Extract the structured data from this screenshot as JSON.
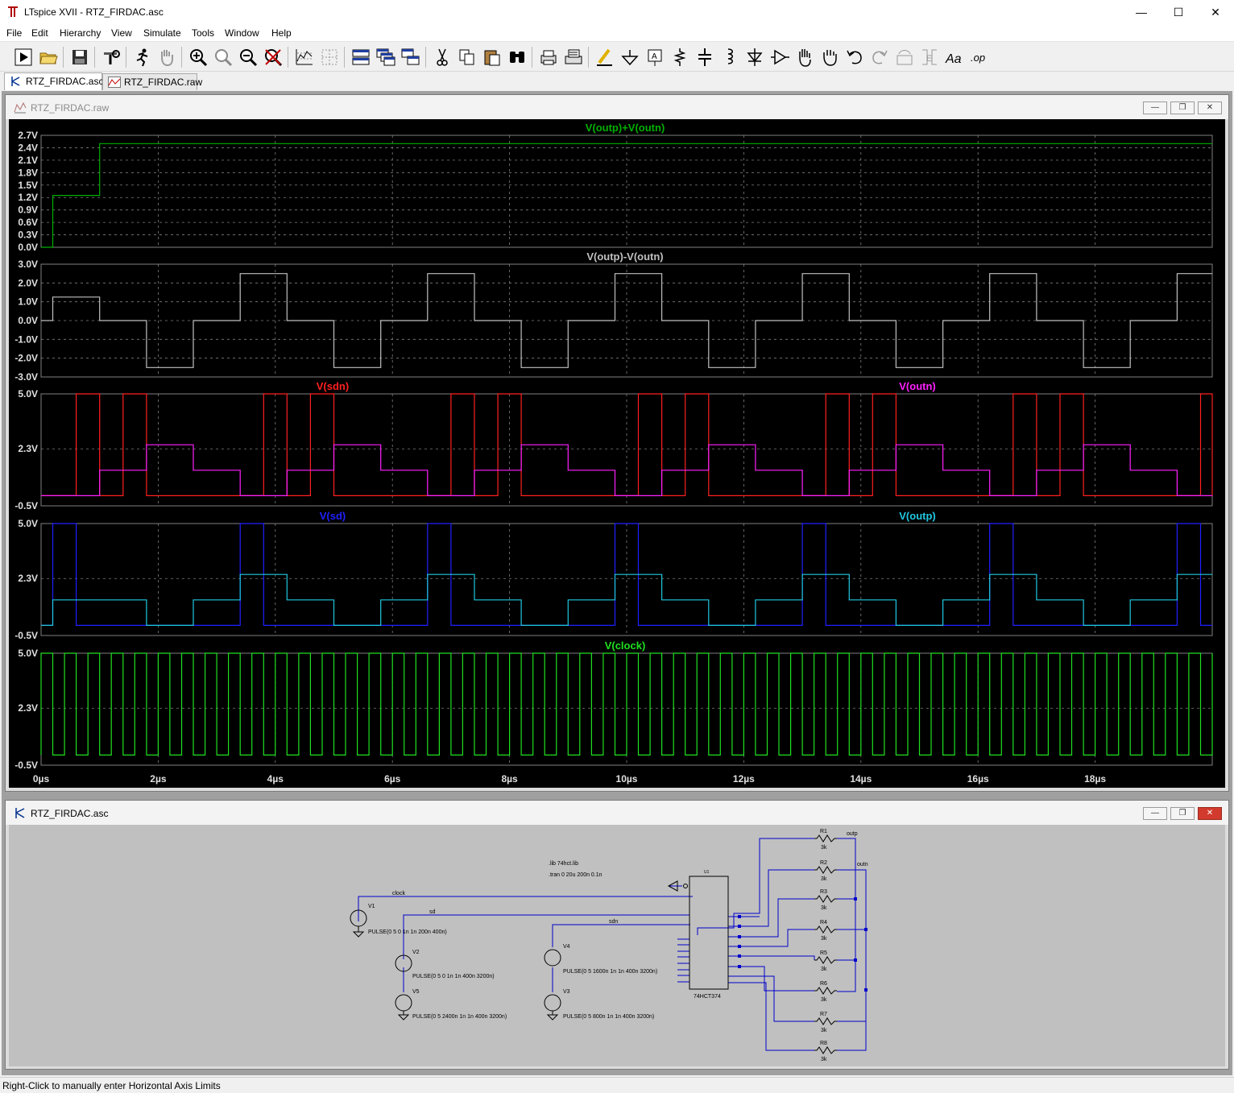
{
  "window": {
    "title": "LTspice XVII - RTZ_FIRDAC.asc",
    "controls": {
      "minimize": "—",
      "maximize": "☐",
      "close": "✕"
    }
  },
  "menu": [
    "File",
    "Edit",
    "Hierarchy",
    "View",
    "Simulate",
    "Tools",
    "Window",
    "Help"
  ],
  "toolbar": {
    "icons": [
      "run-icon",
      "open-icon",
      "save-icon",
      "control-panel-icon",
      "run-halt-icon",
      "pan-hand-icon",
      "zoom-in-icon",
      "zoom-area-icon",
      "zoom-out-icon",
      "zoom-cancel-icon",
      "autorange-icon",
      "grid-icon",
      "tile-horizontal-icon",
      "cascade-icon",
      "tile-vertical-icon",
      "cut-icon",
      "copy-icon",
      "paste-icon",
      "find-icon",
      "print-icon",
      "print-setup-icon",
      "draw-wire-icon",
      "ground-icon",
      "label-net-icon",
      "resistor-icon",
      "capacitor-icon",
      "inductor-icon",
      "diode-icon",
      "component-icon",
      "move-hand-icon",
      "drag-hand-icon",
      "undo-icon",
      "redo-icon",
      "rotate-icon",
      "mirror-icon",
      "text-icon",
      "spice-directive-icon"
    ],
    "text_label": "Aa",
    "op_label": ".op"
  },
  "tabs": [
    {
      "label": "RTZ_FIRDAC.asc",
      "icon": "schematic-icon",
      "active": true
    },
    {
      "label": "RTZ_FIRDAC.raw",
      "icon": "waveform-icon",
      "active": false
    }
  ],
  "waveform_window": {
    "title": "RTZ_FIRDAC.raw",
    "buttons": [
      "—",
      "❐",
      "✕"
    ]
  },
  "schematic_window": {
    "title": "RTZ_FIRDAC.asc",
    "buttons": [
      "—",
      "❐",
      "✕"
    ],
    "directives": [
      ".lib 74hct.lib",
      ".tran 0 20u 200n 0.1n"
    ],
    "nets": [
      "clock",
      "sd",
      "sdn",
      "outp",
      "outn"
    ],
    "sources": [
      {
        "name": "V1",
        "value": "PULSE(0 5 0 1n 1n 200n 400n)"
      },
      {
        "name": "V2",
        "value": "PULSE(0 5 0 1n 1n 400n 3200n)"
      },
      {
        "name": "V5",
        "value": "PULSE(0 5 2400n 1n 1n 400n 3200n)"
      },
      {
        "name": "V4",
        "value": "PULSE(0 5 1600n 1n 1n 400n 3200n)"
      },
      {
        "name": "V3",
        "value": "PULSE(0 5 800n 1n 1n 400n 3200n)"
      }
    ],
    "ic": {
      "ref": "U1",
      "part": "74HCT374"
    },
    "resistors": [
      {
        "name": "R1",
        "value": "3k"
      },
      {
        "name": "R2",
        "value": "3k"
      },
      {
        "name": "R3",
        "value": "3k"
      },
      {
        "name": "R4",
        "value": "3k"
      },
      {
        "name": "R5",
        "value": "3k"
      },
      {
        "name": "R6",
        "value": "3k"
      },
      {
        "name": "R7",
        "value": "3k"
      },
      {
        "name": "R8",
        "value": "3k"
      }
    ],
    "wire_color": "#0000cc"
  },
  "statusbar": {
    "text": "Right-Click to manually enter Horizontal Axis Limits"
  },
  "colors": {
    "plot_bg": "#000000",
    "grid": "#808080",
    "sum": "#00b000",
    "diff": "#c0c0c0",
    "sdn": "#ff2020",
    "outn": "#ff20ff",
    "sd": "#2020ff",
    "outp": "#20c8e0",
    "clock": "#20e020"
  },
  "chart_data": [
    {
      "type": "line",
      "title": "V(outp)+V(outn)",
      "series": [
        {
          "name": "V(outp)+V(outn)",
          "x": [
            0,
            0.2,
            0.2,
            1.0,
            1.0,
            20
          ],
          "y": [
            0,
            0,
            1.25,
            1.25,
            2.5,
            2.5
          ]
        }
      ],
      "yticks": [
        "0.0V",
        "0.3V",
        "0.6V",
        "0.9V",
        "1.2V",
        "1.5V",
        "1.8V",
        "2.1V",
        "2.4V",
        "2.7V"
      ],
      "ylim": [
        0,
        2.7
      ]
    },
    {
      "type": "line",
      "title": "V(outp)-V(outn)",
      "series": [
        {
          "name": "V(outp)-V(outn)",
          "x": [
            0,
            0.2,
            0.2,
            1.0,
            1.0,
            1.8,
            1.8,
            2.6,
            2.6,
            3.4,
            3.4,
            4.2,
            4.2,
            5.0,
            5.0,
            5.8,
            5.8,
            6.6,
            6.6,
            7.4,
            7.4,
            8.2,
            8.2,
            9.0,
            9.0,
            9.8,
            9.8,
            10.6,
            10.6,
            11.4,
            11.4,
            12.2,
            12.2,
            13.0,
            13.0,
            13.8,
            13.8,
            14.6,
            14.6,
            15.4,
            15.4,
            16.2,
            16.2,
            17.0,
            17.0,
            17.8,
            17.8,
            18.6,
            18.6,
            19.4,
            19.4,
            20
          ],
          "y": [
            0,
            0,
            1.25,
            1.25,
            0,
            0,
            -2.5,
            -2.5,
            0,
            0,
            2.5,
            2.5,
            0,
            0,
            -2.5,
            -2.5,
            0,
            0,
            2.5,
            2.5,
            0,
            0,
            -2.5,
            -2.5,
            0,
            0,
            2.5,
            2.5,
            0,
            0,
            -2.5,
            -2.5,
            0,
            0,
            2.5,
            2.5,
            0,
            0,
            -2.5,
            -2.5,
            0,
            0,
            2.5,
            2.5,
            0,
            0,
            -2.5,
            -2.5,
            0,
            0,
            2.5,
            2.5
          ]
        }
      ],
      "yticks": [
        "-3.0V",
        "-2.0V",
        "-1.0V",
        "0.0V",
        "1.0V",
        "2.0V",
        "3.0V"
      ],
      "ylim": [
        -3,
        3
      ]
    },
    {
      "type": "line",
      "series": [
        {
          "name": "V(sdn)",
          "kind": "pulse",
          "delay": 0.6,
          "width": 0.4,
          "period": 3.2,
          "offset_pulses": [
            0.0,
            0.8
          ],
          "high": 5,
          "low": 0
        },
        {
          "name": "V(outn)",
          "kind": "stair",
          "x": [
            0,
            1.0,
            1.0,
            1.8,
            1.8,
            2.6,
            2.6,
            3.4,
            3.4,
            4.2,
            4.2,
            5.0,
            5.0,
            5.8,
            5.8,
            6.6,
            6.6,
            7.4,
            7.4,
            8.2,
            8.2,
            9.0,
            9.0,
            9.8,
            9.8,
            10.6,
            10.6,
            11.4,
            11.4,
            12.2,
            12.2,
            13.0,
            13.0,
            13.8,
            13.8,
            14.6,
            14.6,
            15.4,
            15.4,
            16.2,
            16.2,
            17.0,
            17.0,
            17.8,
            17.8,
            18.6,
            18.6,
            19.4,
            19.4,
            20
          ],
          "y": [
            0,
            0,
            1.25,
            1.25,
            2.5,
            2.5,
            1.25,
            1.25,
            0,
            0,
            1.25,
            1.25,
            2.5,
            2.5,
            1.25,
            1.25,
            0,
            0,
            1.25,
            1.25,
            2.5,
            2.5,
            1.25,
            1.25,
            0,
            0,
            1.25,
            1.25,
            2.5,
            2.5,
            1.25,
            1.25,
            0,
            0,
            1.25,
            1.25,
            2.5,
            2.5,
            1.25,
            1.25,
            0,
            0,
            1.25,
            1.25,
            2.5,
            2.5,
            1.25,
            1.25,
            0,
            0
          ]
        }
      ],
      "yticks": [
        "-0.5V",
        "2.3V",
        "5.0V"
      ],
      "ylim": [
        -0.5,
        5.0
      ]
    },
    {
      "type": "line",
      "series": [
        {
          "name": "V(sd)",
          "kind": "pulse",
          "delay": 0.2,
          "width": 0.4,
          "period": 3.2,
          "high": 5,
          "low": 0
        },
        {
          "name": "V(outp)",
          "kind": "stair",
          "x": [
            0,
            0.2,
            0.2,
            1.8,
            1.8,
            2.6,
            2.6,
            3.4,
            3.4,
            4.2,
            4.2,
            5.0,
            5.0,
            5.8,
            5.8,
            6.6,
            6.6,
            7.4,
            7.4,
            8.2,
            8.2,
            9.0,
            9.0,
            9.8,
            9.8,
            10.6,
            10.6,
            11.4,
            11.4,
            12.2,
            12.2,
            13.0,
            13.0,
            13.8,
            13.8,
            14.6,
            14.6,
            15.4,
            15.4,
            16.2,
            16.2,
            17.0,
            17.0,
            17.8,
            17.8,
            18.6,
            18.6,
            19.4,
            19.4,
            20
          ],
          "y": [
            0,
            0,
            1.25,
            1.25,
            0,
            0,
            1.25,
            1.25,
            2.5,
            2.5,
            1.25,
            1.25,
            0,
            0,
            1.25,
            1.25,
            2.5,
            2.5,
            1.25,
            1.25,
            0,
            0,
            1.25,
            1.25,
            2.5,
            2.5,
            1.25,
            1.25,
            0,
            0,
            1.25,
            1.25,
            2.5,
            2.5,
            1.25,
            1.25,
            0,
            0,
            1.25,
            1.25,
            2.5,
            2.5,
            1.25,
            1.25,
            0,
            0,
            1.25,
            1.25,
            2.5,
            2.5
          ]
        }
      ],
      "yticks": [
        "-0.5V",
        "2.3V",
        "5.0V"
      ],
      "ylim": [
        -0.5,
        5.0
      ]
    },
    {
      "type": "line",
      "title": "V(clock)",
      "series": [
        {
          "name": "V(clock)",
          "kind": "pulse",
          "delay": 0,
          "width": 0.2,
          "period": 0.4,
          "high": 5,
          "low": 0
        }
      ],
      "yticks": [
        "-0.5V",
        "2.3V",
        "5.0V"
      ],
      "ylim": [
        -0.5,
        5.0
      ]
    }
  ],
  "x_axis": {
    "ticks": [
      "0µs",
      "2µs",
      "4µs",
      "6µs",
      "8µs",
      "10µs",
      "12µs",
      "14µs",
      "16µs",
      "18µs"
    ],
    "xlim": [
      0,
      20
    ]
  }
}
